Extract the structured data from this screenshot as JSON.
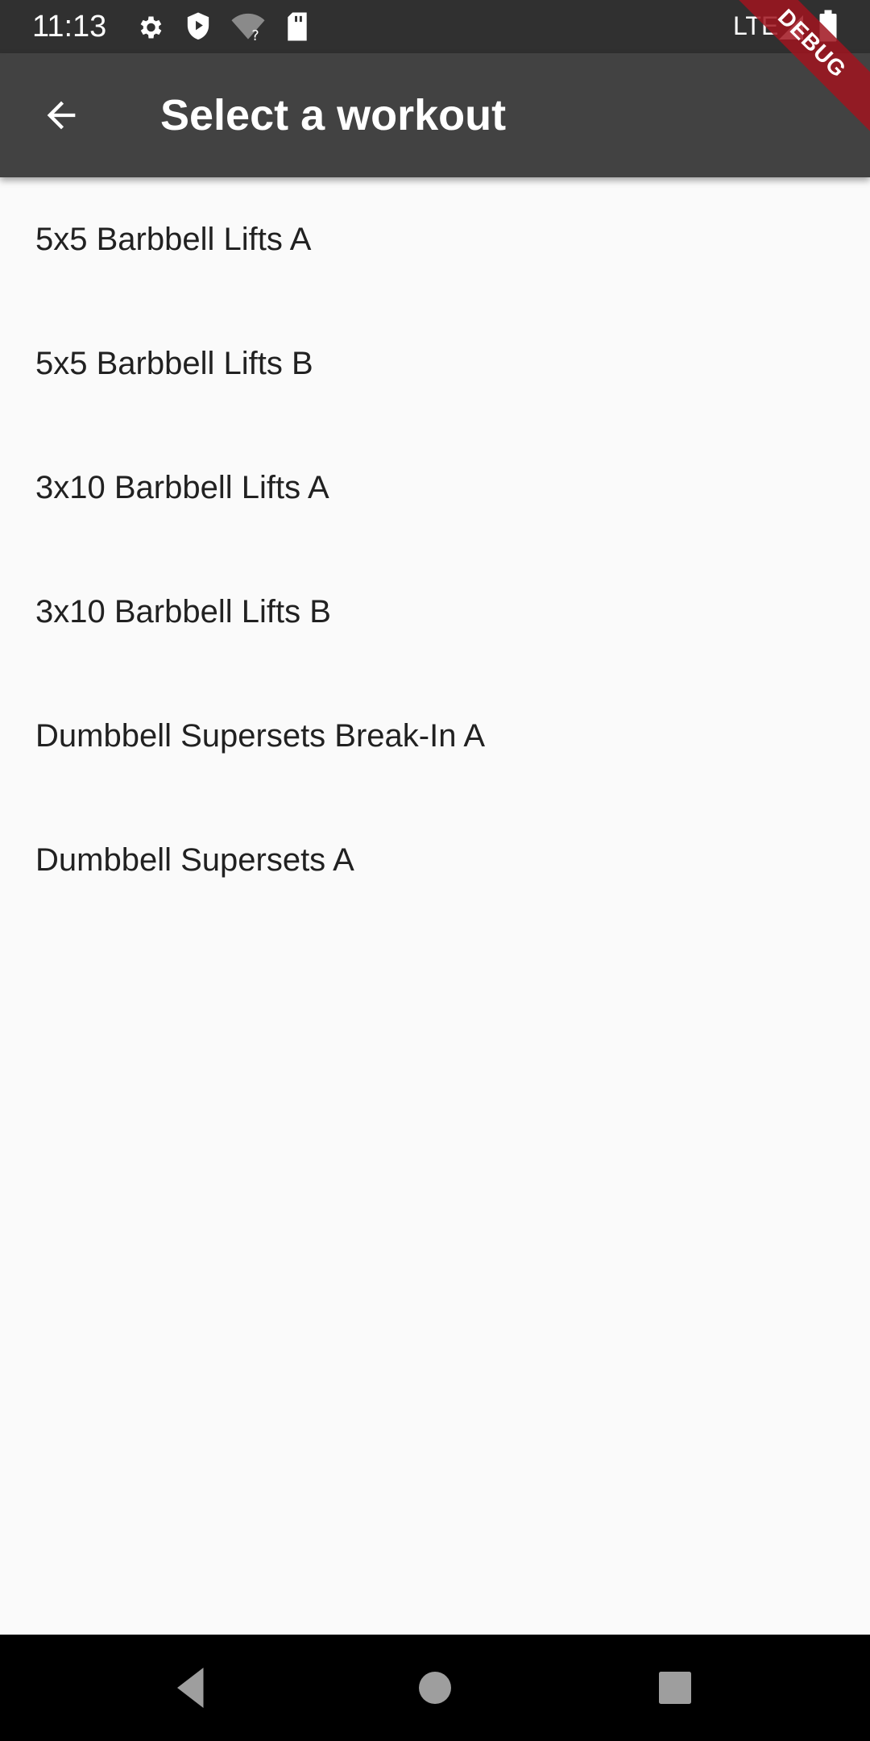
{
  "status_bar": {
    "time": "11:13",
    "network": "LTE",
    "icons": [
      "settings-icon",
      "shield-icon",
      "wifi-unknown-icon",
      "sd-card-icon",
      "signal-icon",
      "battery-icon"
    ]
  },
  "app_bar": {
    "title": "Select a workout",
    "back_icon": "arrow-back-icon"
  },
  "debug_banner": "DEBUG",
  "workouts": [
    "5x5 Barbbell Lifts A",
    "5x5 Barbbell Lifts B",
    "3x10 Barbbell Lifts A",
    "3x10 Barbbell Lifts B",
    "Dumbbell Supersets Break-In A",
    "Dumbbell Supersets A"
  ],
  "nav_bar": {
    "buttons": [
      "back-triangle-icon",
      "home-circle-icon",
      "recents-square-icon"
    ]
  },
  "colors": {
    "status_bar": "#303030",
    "app_bar": "#424242",
    "background": "#fafafa",
    "text": "#212121",
    "debug": "#a0141e"
  }
}
